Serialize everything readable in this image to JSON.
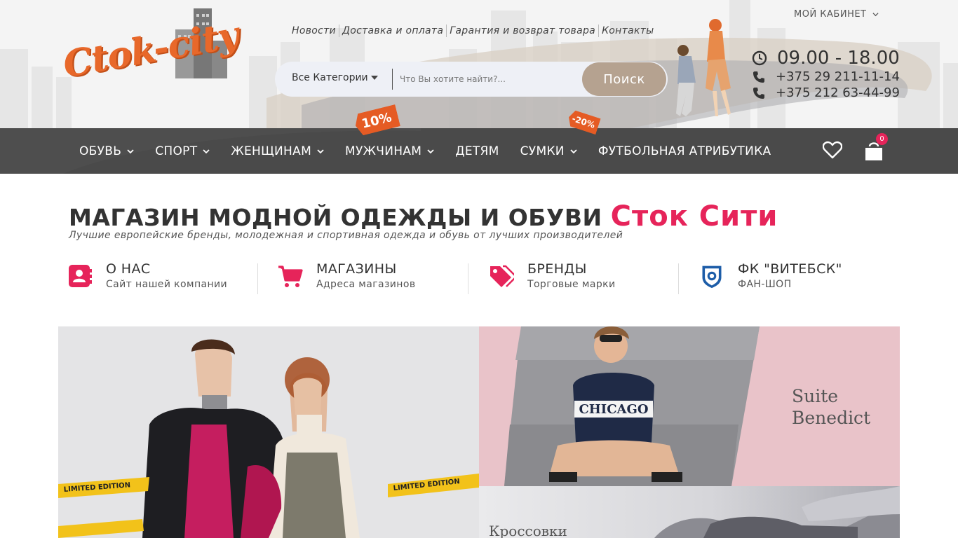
{
  "header": {
    "logo_text": "Ctok-city",
    "top_links": [
      "Новости",
      "Доставка и оплата",
      "Гарантия и возврат товара",
      "Контакты"
    ],
    "cabinet_label": "МОЙ КАБИНЕТ",
    "search": {
      "category": "Все Категории",
      "placeholder": "Что Вы хотите найти?...",
      "button": "Поиск"
    },
    "hours": "09.00 - 18.00",
    "phones": [
      "+375 29 211-11-14",
      "+375 212 63-44-99"
    ],
    "promo_tags": [
      "10%",
      "-20%"
    ]
  },
  "nav": {
    "items": [
      {
        "label": "ОБУВЬ",
        "dropdown": true
      },
      {
        "label": "СПОРТ",
        "dropdown": true
      },
      {
        "label": "ЖЕНЩИНАМ",
        "dropdown": true
      },
      {
        "label": "МУЖЧИНАМ",
        "dropdown": true
      },
      {
        "label": "ДЕТЯМ",
        "dropdown": false
      },
      {
        "label": "СУМКИ",
        "dropdown": true
      },
      {
        "label": "ФУТБОЛЬНАЯ АТРИБУТИКА",
        "dropdown": false
      }
    ],
    "cart_count": "0"
  },
  "content": {
    "headline": "МАГАЗИН МОДНОЙ ОДЕЖДЫ И ОБУВИ",
    "headline_accent": "Сток Сити",
    "subline": "Лучшие европейские бренды, молодежная и спортивная одежда и обувь от лучших производителей",
    "features": [
      {
        "title": "О НАС",
        "subtitle": "Сайт нашей компании",
        "icon": "address-book-icon"
      },
      {
        "title": "МАГАЗИНЫ",
        "subtitle": "Адреса магазинов",
        "icon": "cart-icon"
      },
      {
        "title": "БРЕНДЫ",
        "subtitle": "Торговые марки",
        "icon": "tags-icon"
      },
      {
        "title": "ФК \"ВИТЕБСК\"",
        "subtitle": "ФАН-ШОП",
        "icon": "fc-vitebsk-crest-icon"
      }
    ]
  },
  "banners": {
    "left_tape_text": "LIMITED EDITION",
    "sweater_text": "CHICAGO",
    "brand_line1": "Suite",
    "brand_line2": "Benedict",
    "sneakers_label": "Кроссовки"
  },
  "colors": {
    "accent_pink": "#e6245a",
    "logo_orange": "#e8682a",
    "nav_bg": "#4a4a4a",
    "search_button": "#b5a290",
    "banner_pink": "#e9c3c9"
  }
}
